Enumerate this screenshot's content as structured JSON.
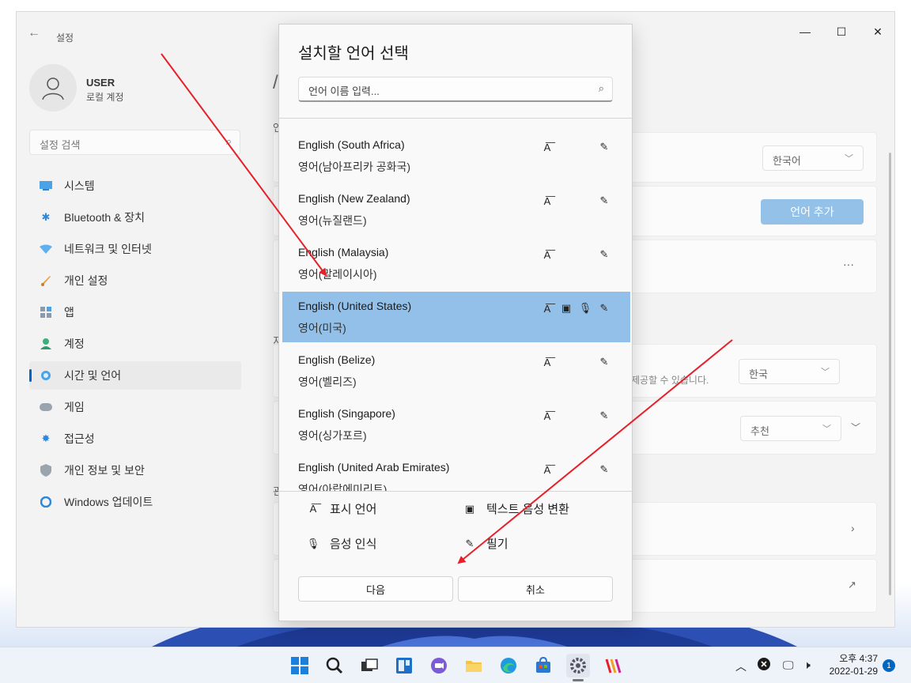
{
  "settings_window": {
    "title": "설정",
    "user": {
      "name": "USER",
      "account_type": "로컬 계정"
    },
    "search_placeholder": "설정 검색",
    "nav_items": [
      {
        "label": "시스템",
        "icon": "monitor-icon"
      },
      {
        "label": "Bluetooth & 장치",
        "icon": "bluetooth-icon"
      },
      {
        "label": "네트워크 및 인터넷",
        "icon": "wifi-icon"
      },
      {
        "label": "개인 설정",
        "icon": "brush-icon"
      },
      {
        "label": "앱",
        "icon": "apps-icon"
      },
      {
        "label": "계정",
        "icon": "account-icon"
      },
      {
        "label": "시간 및 언어",
        "icon": "globe-clock-icon",
        "selected": true
      },
      {
        "label": "게임",
        "icon": "gamepad-icon"
      },
      {
        "label": "접근성",
        "icon": "accessibility-icon"
      },
      {
        "label": "개인 정보 및 보안",
        "icon": "shield-icon"
      },
      {
        "label": "Windows 업데이트",
        "icon": "update-icon"
      }
    ],
    "main": {
      "display_language_value": "한국어",
      "add_language_button": "언어 추가",
      "more_options": "···",
      "region_note": "제공할 수 있습니다.",
      "region_value": "한국",
      "format_value": "추천"
    }
  },
  "dialog": {
    "title": "설치할 언어 선택",
    "search_placeholder": "언어 이름 입력...",
    "languages": [
      {
        "name_en": "English (South Africa)",
        "name_ko": "영어(남아프리카 공화국)",
        "features": [
          "display-language",
          "handwriting"
        ]
      },
      {
        "name_en": "English (New Zealand)",
        "name_ko": "영어(뉴질랜드)",
        "features": [
          "display-language",
          "handwriting"
        ]
      },
      {
        "name_en": "English (Malaysia)",
        "name_ko": "영어(말레이시아)",
        "features": [
          "display-language",
          "handwriting"
        ]
      },
      {
        "name_en": "English (United States)",
        "name_ko": "영어(미국)",
        "features": [
          "display-language",
          "text-to-speech",
          "speech-recognition",
          "handwriting"
        ],
        "selected": true
      },
      {
        "name_en": "English (Belize)",
        "name_ko": "영어(벨리즈)",
        "features": [
          "display-language",
          "handwriting"
        ]
      },
      {
        "name_en": "English (Singapore)",
        "name_ko": "영어(싱가포르)",
        "features": [
          "display-language",
          "handwriting"
        ]
      },
      {
        "name_en": "English (United Arab Emirates)",
        "name_ko": "영어(아랍에미리트)",
        "features": [
          "display-language",
          "handwriting"
        ]
      }
    ],
    "legend": {
      "display_language": "표시 언어",
      "text_to_speech": "텍스트 음성 변환",
      "speech_recognition": "음성 인식",
      "handwriting": "필기"
    },
    "next_button": "다음",
    "cancel_button": "취소"
  },
  "taskbar": {
    "apps": [
      "start-icon",
      "search-icon",
      "task-view-icon",
      "widgets-icon",
      "chat-icon",
      "file-explorer-icon",
      "edge-icon",
      "store-icon",
      "settings-icon",
      "app-icon"
    ],
    "clock_time": "오후 4:37",
    "clock_date": "2022-01-29",
    "notification_count": "1"
  },
  "annotation_color": "#e5202a"
}
